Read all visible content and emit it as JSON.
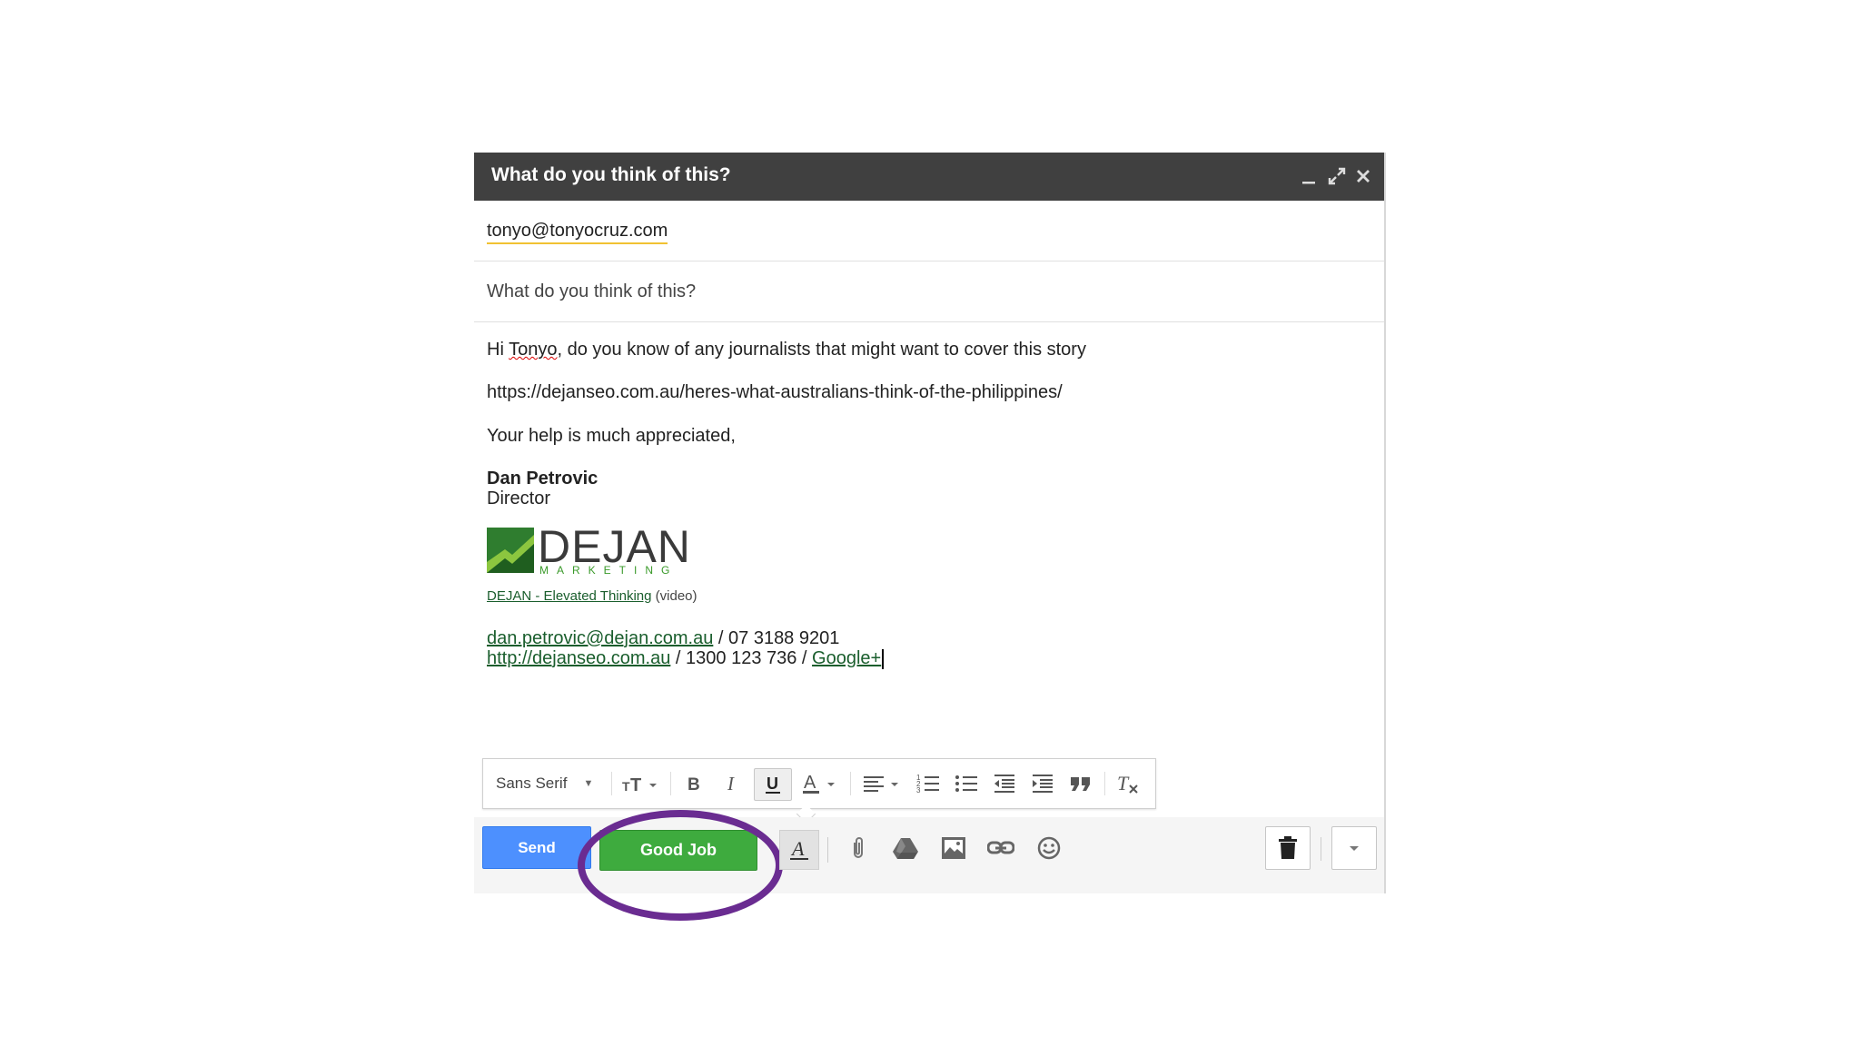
{
  "window": {
    "title": "What do you think of this?",
    "controls": [
      "minimize-icon",
      "expand-icon",
      "close-icon"
    ]
  },
  "to": "tonyo@tonyocruz.com",
  "subject": "What do you think of this?",
  "body": {
    "line1_a": "Hi ",
    "line1_name": "Tonyo",
    "line1_b": ", do you know of any journalists that might want to cover this story",
    "url": "https://dejanseo.com.au/heres-what-australians-think-of-the-philippines/",
    "closing": "Your help is much appreciated,"
  },
  "signature": {
    "name": "Dan Petrovic",
    "role": "Director",
    "logo_text": "DEJAN",
    "logo_sub": "MARKETING",
    "video_link": "DEJAN - Elevated Thinking",
    "video_note": " (video)",
    "email": "dan.petrovic@dejan.com.au",
    "phone": " / 07 3188 9201",
    "website": "http://dejanseo.com.au",
    "phone2": " / 1300 123 736 / ",
    "google": "Google+"
  },
  "format_toolbar": {
    "font": "Sans Serif",
    "icons": [
      "text-size-icon",
      "bold-icon",
      "italic-icon",
      "underline-icon",
      "text-color-icon",
      "align-icon",
      "numbered-list-icon",
      "bulleted-list-icon",
      "indent-less-icon",
      "indent-more-icon",
      "quote-icon",
      "remove-formatting-icon"
    ]
  },
  "actions": {
    "send_label": "Send",
    "good_job_label": "Good Job",
    "icons": [
      "formatting-icon",
      "attach-icon",
      "drive-icon",
      "photo-icon",
      "link-icon",
      "emoji-icon",
      "trash-icon",
      "more-options-icon"
    ]
  },
  "colors": {
    "titlebar": "#404040",
    "send": "#4d90fe",
    "good_job": "#3eab3e",
    "highlight_ring": "#6a2c91",
    "link": "#1a5e2d"
  }
}
